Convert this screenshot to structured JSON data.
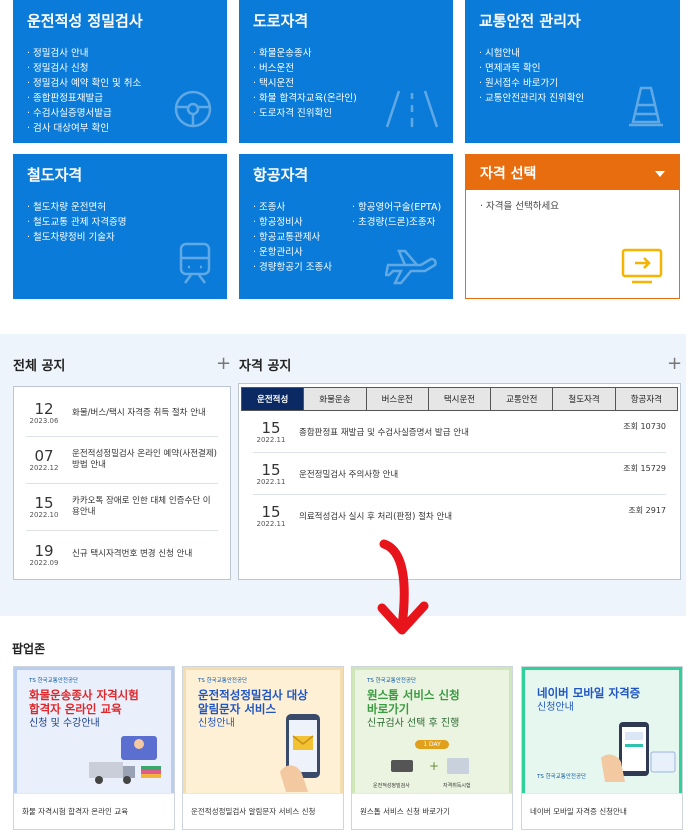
{
  "tiles": {
    "t1": {
      "title": "운전적성 정밀검사",
      "items": [
        "정밀검사 안내",
        "정밀검사 신청",
        "정밀검사 예약 확인 및 취소",
        "종합판정표재발급",
        "수검사실증명서발급",
        "검사 대상여부 확인"
      ],
      "icon": "steering-wheel-icon"
    },
    "t2": {
      "title": "도로자격",
      "items": [
        "화물운송종사",
        "버스운전",
        "택시운전",
        "화물 합격자교육(온라인)",
        "도로자격 진위확인"
      ],
      "icon": "road-icon"
    },
    "t3": {
      "title": "교통안전 관리자",
      "items": [
        "시험안내",
        "면제과목 확인",
        "원서접수 바로가기",
        "교통안전관리자 진위확인"
      ],
      "icon": "traffic-cone-icon"
    },
    "t4": {
      "title": "철도자격",
      "items": [
        "철도차량 운전면허",
        "철도교통 관제 자격증명",
        "철도차량정비 기술자"
      ],
      "icon": "train-icon"
    },
    "t5": {
      "title": "항공자격",
      "col1": [
        "조종사",
        "항공정비사",
        "항공교통관제사",
        "운항관리사",
        "경량항공기 조종사"
      ],
      "col2": [
        "항공영어구술(EPTA)",
        "초경량(드론)조종자"
      ],
      "icon": "airplane-icon"
    },
    "select": {
      "title": "자격 선택",
      "placeholder": "자격을 선택하세요",
      "icon": "monitor-arrow-icon"
    }
  },
  "colors": {
    "blue": "#0a7bd8",
    "orange": "#e86d0f",
    "navy": "#0b2a64"
  },
  "all_notice": {
    "title": "전체 공지",
    "items": [
      {
        "day": "12",
        "ym": "2023.06",
        "text": "화물/버스/택시 자격증 취득 절차 안내"
      },
      {
        "day": "07",
        "ym": "2022.12",
        "text": "운전적성정밀검사 온라인 예약(사전결제) 방법 안내"
      },
      {
        "day": "15",
        "ym": "2022.10",
        "text": "카카오톡 장애로 인한 대체 인증수단 이용안내"
      },
      {
        "day": "19",
        "ym": "2022.09",
        "text": "신규 택시자격번호 변경 신청 안내"
      }
    ]
  },
  "qual_notice": {
    "title": "자격 공지",
    "tabs": [
      "운전적성",
      "화물운송",
      "버스운전",
      "택시운전",
      "교통안전",
      "철도자격",
      "항공자격"
    ],
    "items": [
      {
        "day": "15",
        "ym": "2022.11",
        "text": "종합판정표 재발급 및 수검사실증명서 발급 안내",
        "views": "조회 10730"
      },
      {
        "day": "15",
        "ym": "2022.11",
        "text": "운전정밀검사 주의사항 안내",
        "views": "조회 15729"
      },
      {
        "day": "15",
        "ym": "2022.11",
        "text": "의료적성검사 실시 후 처리(판정) 절차 안내",
        "views": "조회 2917"
      }
    ]
  },
  "popup": {
    "title": "팝업존",
    "cards": [
      {
        "brand": "TS 한국교통안전공단",
        "headline1": "화물운송종사 자격시험",
        "headline2": "합격자 온라인 교육",
        "sub": "신청 및 수강안내",
        "caption": "화물 자격시험 합격자 온라인 교육"
      },
      {
        "brand": "TS 한국교통안전공단",
        "headline1": "운전적성정밀검사 대상",
        "headline2": "알림문자 서비스",
        "sub": "신청안내",
        "caption": "운전적성정밀검사 알림문자 서비스 신청"
      },
      {
        "brand": "TS 한국교통안전공단",
        "headline1": "원스톱 서비스 신청",
        "headline2": "바로가기",
        "sub": "신규검사 선택 후 진행",
        "pill": "1 DAY",
        "lbl1": "운전적성정밀검사",
        "lbl2": "자격취득시험",
        "caption": "원스톱 서비스 신청 바로가기"
      },
      {
        "brand": "TS 한국교통안전공단",
        "headline1": "네이버 모바일 자격증",
        "headline2": "신청안내",
        "sub": "",
        "caption": "네이버 모바일 자격증 신청안내"
      }
    ]
  }
}
